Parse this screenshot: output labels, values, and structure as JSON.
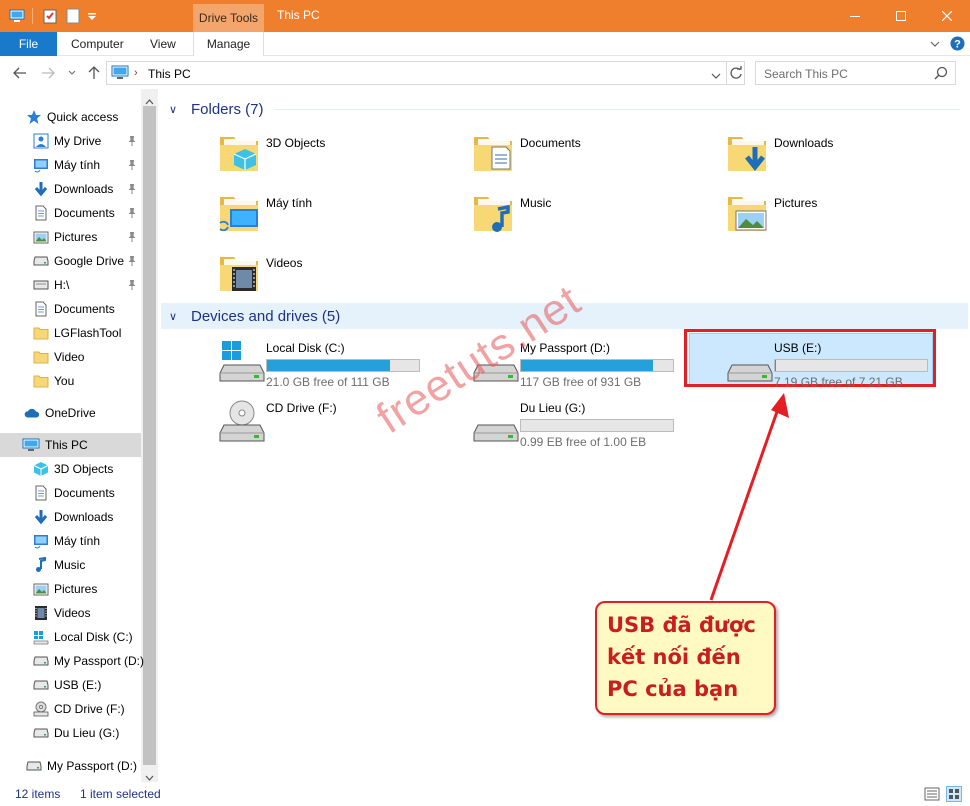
{
  "titlebar": {
    "context_tab": "Drive Tools",
    "title": "This PC"
  },
  "ribbon": {
    "tabs": [
      "File",
      "Computer",
      "View",
      "Manage"
    ]
  },
  "address": {
    "path": "This PC",
    "search_placeholder": "Search This PC"
  },
  "nav": {
    "quick_access": "Quick access",
    "quick_items": [
      {
        "label": "My Drive",
        "icon": "my-drive-icon"
      },
      {
        "label": "Máy tính",
        "icon": "computer-folder-icon"
      },
      {
        "label": "Downloads",
        "icon": "downloads-icon"
      },
      {
        "label": "Documents",
        "icon": "documents-icon"
      },
      {
        "label": "Pictures",
        "icon": "pictures-icon"
      },
      {
        "label": "Google Drive",
        "icon": "google-drive-icon"
      },
      {
        "label": "H:\\",
        "icon": "drive-h-icon"
      },
      {
        "label": "Documents",
        "icon": "documents-icon"
      },
      {
        "label": "LGFlashTool",
        "icon": "folder-icon"
      },
      {
        "label": "Video",
        "icon": "folder-icon"
      },
      {
        "label": "You",
        "icon": "folder-icon"
      }
    ],
    "onedrive": "OneDrive",
    "this_pc": "This PC",
    "pc_items": [
      {
        "label": "3D Objects",
        "icon": "3d-objects-icon"
      },
      {
        "label": "Documents",
        "icon": "documents-icon"
      },
      {
        "label": "Downloads",
        "icon": "downloads-icon"
      },
      {
        "label": "Máy tính",
        "icon": "computer-folder-icon"
      },
      {
        "label": "Music",
        "icon": "music-icon"
      },
      {
        "label": "Pictures",
        "icon": "pictures-icon"
      },
      {
        "label": "Videos",
        "icon": "videos-icon"
      },
      {
        "label": "Local Disk (C:)",
        "icon": "windows-drive-icon"
      },
      {
        "label": "My Passport (D:)",
        "icon": "drive-icon"
      },
      {
        "label": "USB (E:)",
        "icon": "usb-drive-icon"
      },
      {
        "label": "CD Drive (F:)",
        "icon": "cd-drive-icon"
      },
      {
        "label": "Du Lieu (G:)",
        "icon": "drive-icon"
      }
    ],
    "bottom_item": "My Passport (D:)"
  },
  "folders": {
    "header": "Folders (7)",
    "items": [
      {
        "label": "3D Objects",
        "icon": "3d-objects-icon"
      },
      {
        "label": "Documents",
        "icon": "documents-icon"
      },
      {
        "label": "Downloads",
        "icon": "downloads-icon"
      },
      {
        "label": "Máy tính",
        "icon": "computer-folder-icon"
      },
      {
        "label": "Music",
        "icon": "music-icon"
      },
      {
        "label": "Pictures",
        "icon": "pictures-icon"
      },
      {
        "label": "Videos",
        "icon": "videos-icon"
      }
    ]
  },
  "drives": {
    "header": "Devices and drives (5)",
    "items": [
      {
        "label": "Local Disk (C:)",
        "free": "21.0 GB free of 111 GB",
        "used_fraction": 0.81,
        "icon": "windows-drive-icon"
      },
      {
        "label": "My Passport (D:)",
        "free": "117 GB free of 931 GB",
        "used_fraction": 0.87,
        "icon": "drive-icon"
      },
      {
        "label": "USB (E:)",
        "free": "7.19 GB free of 7.21 GB",
        "used_fraction": 0.003,
        "icon": "usb-drive-icon"
      },
      {
        "label": "CD Drive (F:)",
        "icon": "cd-drive-icon"
      },
      {
        "label": "Du Lieu (G:)",
        "free": "0.99 EB free of 1.00 EB",
        "used_fraction": 0.0,
        "icon": "drive-icon"
      }
    ]
  },
  "watermark": "freetuts.net",
  "callout": "USB đã được kết nối đến PC của bạn",
  "status": {
    "items": "12 items",
    "selected": "1 item selected"
  },
  "colors": {
    "titlebar": "#ef7f2c",
    "accent": "#1979ca",
    "bar_fill": "#26a0da",
    "annotation_red": "#e31e24",
    "callout_bg": "#fff9c4"
  }
}
